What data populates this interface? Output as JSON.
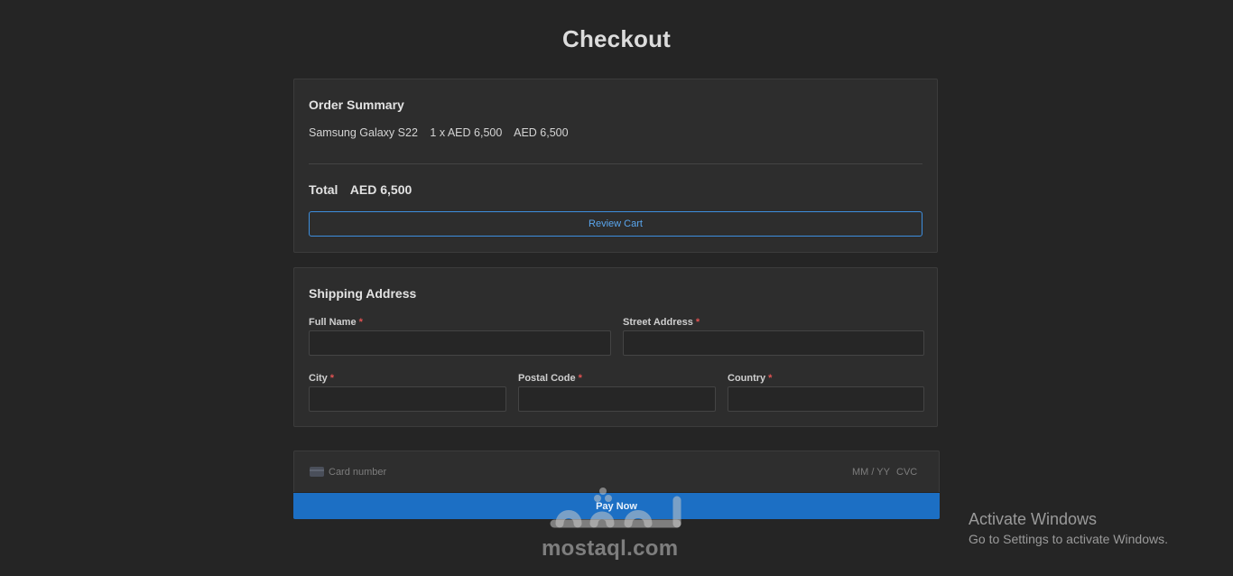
{
  "page": {
    "title": "Checkout"
  },
  "summary": {
    "heading": "Order Summary",
    "item": {
      "name": "Samsung Galaxy S22",
      "qty_price": "1 x AED 6,500",
      "line_total": "AED 6,500"
    },
    "total_label": "Total",
    "total_value": "AED 6,500",
    "review_button": "Review Cart"
  },
  "shipping": {
    "heading": "Shipping Address",
    "required_mark": "*",
    "fields": {
      "full_name": {
        "label": "Full Name",
        "value": ""
      },
      "street": {
        "label": "Street Address",
        "value": ""
      },
      "city": {
        "label": "City",
        "value": ""
      },
      "postal": {
        "label": "Postal Code",
        "value": ""
      },
      "country": {
        "label": "Country",
        "value": ""
      }
    }
  },
  "payment": {
    "card_icon": "credit-card-icon",
    "card_number_placeholder": "Card number",
    "expiry_placeholder": "MM / YY",
    "cvc_placeholder": "CVC",
    "pay_button": "Pay Now"
  },
  "watermark": {
    "text": "mostaql.com"
  },
  "os_notice": {
    "title": "Activate Windows",
    "subtitle": "Go to Settings to activate Windows."
  },
  "colors": {
    "background": "#252525",
    "card": "#2d2d2d",
    "accent": "#1c6fc4",
    "link": "#5aa6ee",
    "required": "#e05252"
  }
}
